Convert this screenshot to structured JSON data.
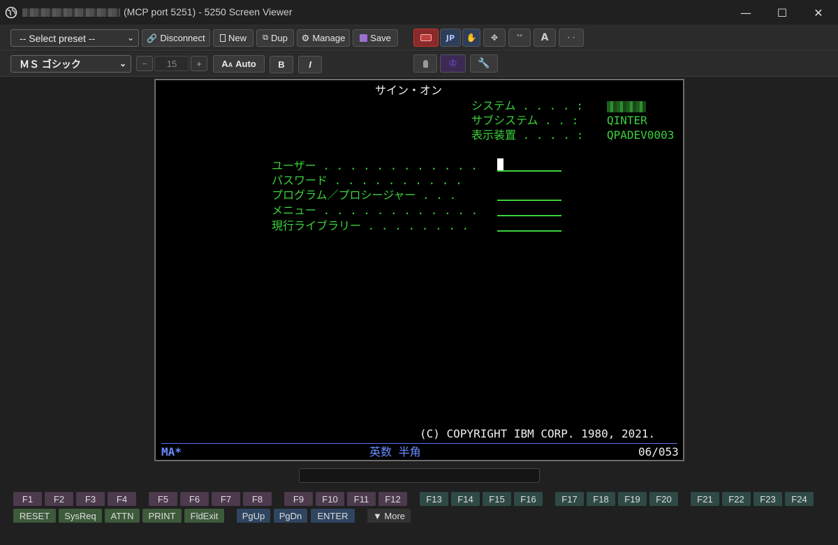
{
  "window": {
    "title": "(MCP port 5251) - 5250 Screen Viewer",
    "min_icon": "minimize-icon",
    "max_icon": "maximize-icon",
    "close_icon": "close-icon"
  },
  "toolbar1": {
    "preset_select": "-- Select preset --",
    "disconnect": "Disconnect",
    "new": "New",
    "dup": "Dup",
    "manage": "Manage",
    "save": "Save",
    "jp_label": "JP",
    "font_a_label": "A",
    "dots_label": "· ·",
    "quote_label": "\"\""
  },
  "toolbar2": {
    "font_select": "ＭＳ ゴシック",
    "minus": "−",
    "font_size": "15",
    "plus": "+",
    "auto": "Auto",
    "auto_prefix": "A",
    "auto_prefix_small": "A",
    "bold": "B",
    "italic": "I"
  },
  "terminal": {
    "title": "サイン・オン",
    "system_label": "システム . . . . :",
    "subsystem_label": "サブシステム . . :",
    "subsystem_value": "QINTER",
    "device_label": "表示装置 . . . . :",
    "device_value": "QPADEV0003",
    "user_label": "ユーザー . . . . . . . . . . . .",
    "password_label": "パスワード . . . . . . . . . .",
    "program_label": "プログラム／プロシージャー . . .",
    "menu_label": "メニュー . . . . . . . . . . . .",
    "library_label": "現行ライブラリー . . . . . . . .",
    "copyright": "(C) COPYRIGHT IBM CORP. 1980, 2021.",
    "status_left": "MA*",
    "status_mid": "英数 半角",
    "status_right": "06/053"
  },
  "fkeys_row1": [
    "F1",
    "F2",
    "F3",
    "F4",
    "F5",
    "F6",
    "F7",
    "F8",
    "F9",
    "F10",
    "F11",
    "F12",
    "F13",
    "F14",
    "F15",
    "F16",
    "F17",
    "F18",
    "F19",
    "F20",
    "F21",
    "F22",
    "F23",
    "F24"
  ],
  "fkeys_row2": {
    "reset": "RESET",
    "sysreq": "SysReq",
    "attn": "ATTN",
    "print": "PRINT",
    "fldexit": "FldExit",
    "pgup": "PgUp",
    "pgdn": "PgDn",
    "enter": "ENTER",
    "more": "▼ More"
  },
  "colors": {
    "terminal_green": "#3ad13a",
    "terminal_blue": "#6a8cff",
    "accent_red": "#c0392b"
  }
}
